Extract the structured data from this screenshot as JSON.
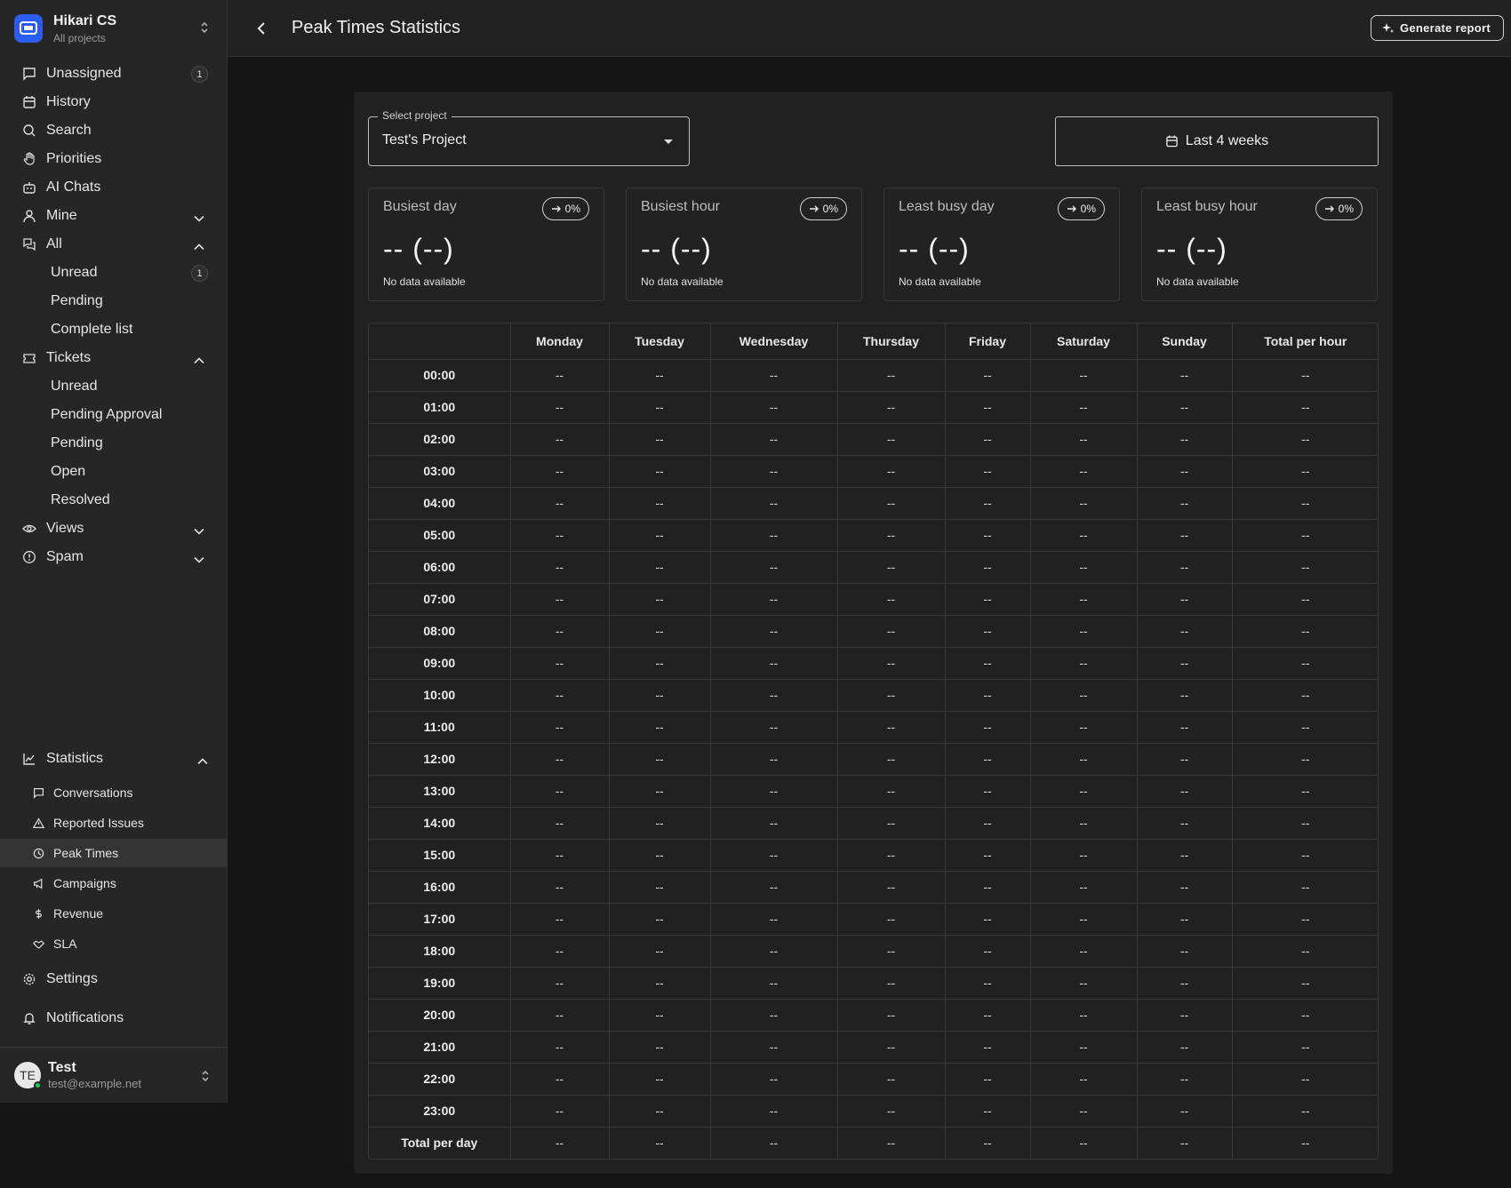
{
  "brand": {
    "title": "Hikari CS",
    "subtitle": "All projects"
  },
  "nav": {
    "unassigned": "Unassigned",
    "unassigned_badge": "1",
    "history": "History",
    "search": "Search",
    "priorities": "Priorities",
    "ai_chats": "AI Chats",
    "mine": "Mine",
    "all": "All",
    "all_unread": "Unread",
    "all_unread_badge": "1",
    "all_pending": "Pending",
    "all_complete": "Complete list",
    "tickets": "Tickets",
    "t_unread": "Unread",
    "t_pending_approval": "Pending Approval",
    "t_pending": "Pending",
    "t_open": "Open",
    "t_resolved": "Resolved",
    "views": "Views",
    "spam": "Spam",
    "statistics": "Statistics",
    "s_conversations": "Conversations",
    "s_reported": "Reported Issues",
    "s_peak": "Peak Times",
    "s_campaigns": "Campaigns",
    "s_revenue": "Revenue",
    "s_sla": "SLA",
    "settings": "Settings",
    "notifications": "Notifications"
  },
  "user": {
    "initials": "TE",
    "name": "Test",
    "email": "test@example.net"
  },
  "header": {
    "title": "Peak Times Statistics",
    "generate": "Generate report"
  },
  "filters": {
    "project_label": "Select project",
    "project_value": "Test's Project",
    "range": "Last 4 weeks"
  },
  "cards": [
    {
      "title": "Busiest day",
      "trend": "0%",
      "value": "-- (--)",
      "note": "No data available"
    },
    {
      "title": "Busiest hour",
      "trend": "0%",
      "value": "-- (--)",
      "note": "No data available"
    },
    {
      "title": "Least busy day",
      "trend": "0%",
      "value": "-- (--)",
      "note": "No data available"
    },
    {
      "title": "Least busy hour",
      "trend": "0%",
      "value": "-- (--)",
      "note": "No data available"
    }
  ],
  "table": {
    "columns": [
      "",
      "Monday",
      "Tuesday",
      "Wednesday",
      "Thursday",
      "Friday",
      "Saturday",
      "Sunday",
      "Total per hour"
    ],
    "rows": [
      [
        "00:00",
        "--",
        "--",
        "--",
        "--",
        "--",
        "--",
        "--",
        "--"
      ],
      [
        "01:00",
        "--",
        "--",
        "--",
        "--",
        "--",
        "--",
        "--",
        "--"
      ],
      [
        "02:00",
        "--",
        "--",
        "--",
        "--",
        "--",
        "--",
        "--",
        "--"
      ],
      [
        "03:00",
        "--",
        "--",
        "--",
        "--",
        "--",
        "--",
        "--",
        "--"
      ],
      [
        "04:00",
        "--",
        "--",
        "--",
        "--",
        "--",
        "--",
        "--",
        "--"
      ],
      [
        "05:00",
        "--",
        "--",
        "--",
        "--",
        "--",
        "--",
        "--",
        "--"
      ],
      [
        "06:00",
        "--",
        "--",
        "--",
        "--",
        "--",
        "--",
        "--",
        "--"
      ],
      [
        "07:00",
        "--",
        "--",
        "--",
        "--",
        "--",
        "--",
        "--",
        "--"
      ],
      [
        "08:00",
        "--",
        "--",
        "--",
        "--",
        "--",
        "--",
        "--",
        "--"
      ],
      [
        "09:00",
        "--",
        "--",
        "--",
        "--",
        "--",
        "--",
        "--",
        "--"
      ],
      [
        "10:00",
        "--",
        "--",
        "--",
        "--",
        "--",
        "--",
        "--",
        "--"
      ],
      [
        "11:00",
        "--",
        "--",
        "--",
        "--",
        "--",
        "--",
        "--",
        "--"
      ],
      [
        "12:00",
        "--",
        "--",
        "--",
        "--",
        "--",
        "--",
        "--",
        "--"
      ],
      [
        "13:00",
        "--",
        "--",
        "--",
        "--",
        "--",
        "--",
        "--",
        "--"
      ],
      [
        "14:00",
        "--",
        "--",
        "--",
        "--",
        "--",
        "--",
        "--",
        "--"
      ],
      [
        "15:00",
        "--",
        "--",
        "--",
        "--",
        "--",
        "--",
        "--",
        "--"
      ],
      [
        "16:00",
        "--",
        "--",
        "--",
        "--",
        "--",
        "--",
        "--",
        "--"
      ],
      [
        "17:00",
        "--",
        "--",
        "--",
        "--",
        "--",
        "--",
        "--",
        "--"
      ],
      [
        "18:00",
        "--",
        "--",
        "--",
        "--",
        "--",
        "--",
        "--",
        "--"
      ],
      [
        "19:00",
        "--",
        "--",
        "--",
        "--",
        "--",
        "--",
        "--",
        "--"
      ],
      [
        "20:00",
        "--",
        "--",
        "--",
        "--",
        "--",
        "--",
        "--",
        "--"
      ],
      [
        "21:00",
        "--",
        "--",
        "--",
        "--",
        "--",
        "--",
        "--",
        "--"
      ],
      [
        "22:00",
        "--",
        "--",
        "--",
        "--",
        "--",
        "--",
        "--",
        "--"
      ],
      [
        "23:00",
        "--",
        "--",
        "--",
        "--",
        "--",
        "--",
        "--",
        "--"
      ]
    ],
    "total_row": [
      "Total per day",
      "--",
      "--",
      "--",
      "--",
      "--",
      "--",
      "--",
      "--"
    ]
  }
}
